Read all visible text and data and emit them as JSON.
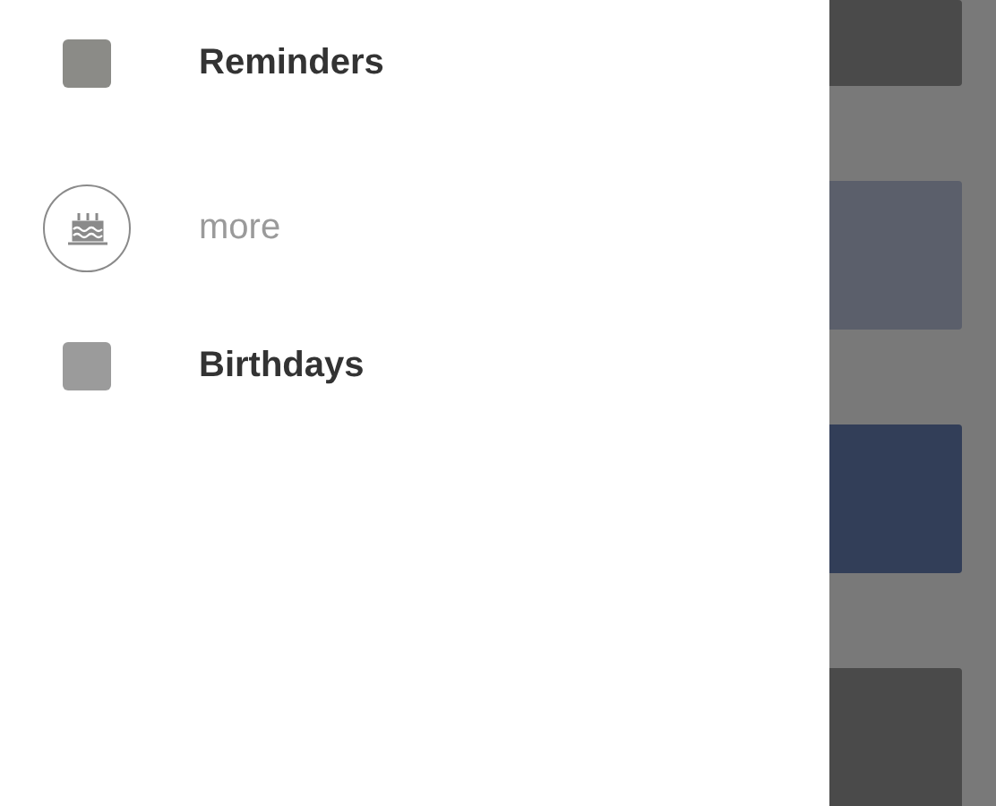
{
  "drawer": {
    "items": [
      {
        "kind": "calendar",
        "label": "Reminders",
        "color": "#8b8b87"
      },
      {
        "kind": "more",
        "label": "more"
      },
      {
        "kind": "calendar",
        "label": "Birthdays",
        "color": "#9b9b9b"
      }
    ]
  },
  "background_cards": [
    {
      "color": "#4a4a4a"
    },
    {
      "color": "#5b5f6b"
    },
    {
      "color": "#323e58"
    },
    {
      "color": "#4a4a4a"
    }
  ]
}
